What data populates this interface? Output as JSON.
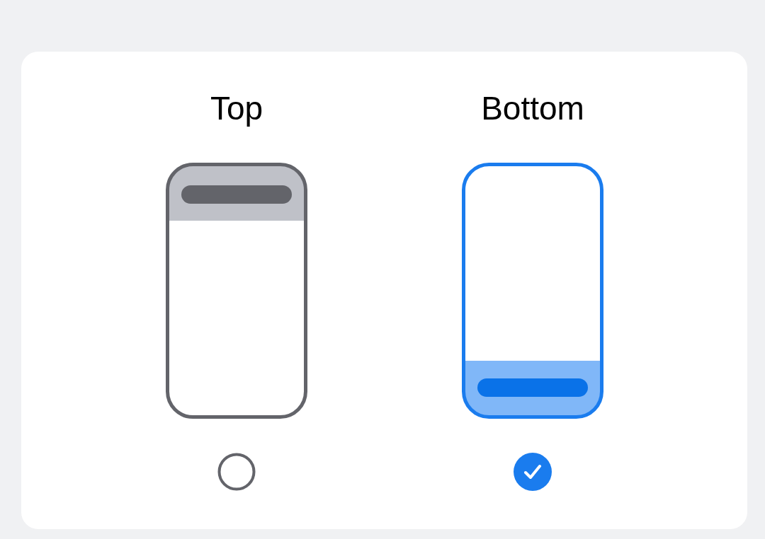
{
  "options": [
    {
      "label": "Top",
      "kind": "top",
      "selected": false
    },
    {
      "label": "Bottom",
      "kind": "bottom",
      "selected": true
    }
  ]
}
